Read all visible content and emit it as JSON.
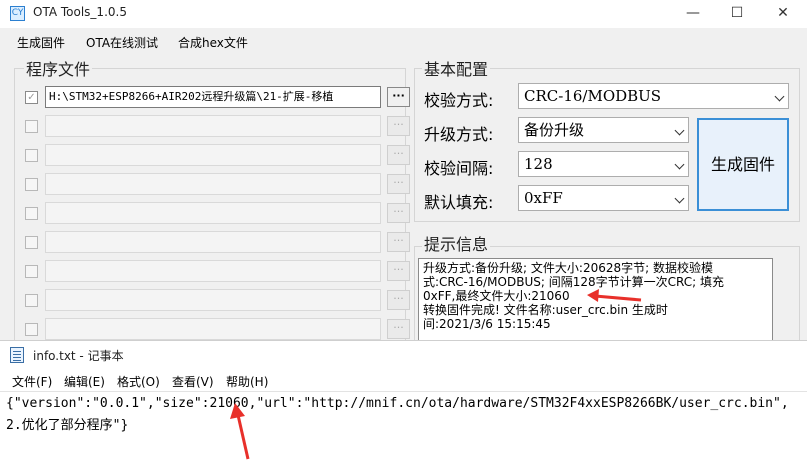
{
  "ota_window": {
    "title": "OTA Tools_1.0.5",
    "icon_text": "CY",
    "controls": {
      "minimize": "—",
      "maximize": "☐",
      "close": "✕"
    },
    "menu": [
      "生成固件",
      "OTA在线测试",
      "合成hex文件"
    ],
    "program_files": {
      "title": "程序文件",
      "rows": [
        {
          "checked": true,
          "path": "H:\\STM32+ESP8266+AIR202远程升级篇\\21-扩展-移植",
          "button": "···"
        },
        {
          "checked": false,
          "path": "",
          "button": "···"
        },
        {
          "checked": false,
          "path": "",
          "button": "···"
        },
        {
          "checked": false,
          "path": "",
          "button": "···"
        },
        {
          "checked": false,
          "path": "",
          "button": "···"
        },
        {
          "checked": false,
          "path": "",
          "button": "···"
        },
        {
          "checked": false,
          "path": "",
          "button": "···"
        },
        {
          "checked": false,
          "path": "",
          "button": "···"
        },
        {
          "checked": false,
          "path": "",
          "button": "···"
        }
      ]
    },
    "basic_config": {
      "title": "基本配置",
      "verify_method_label": "校验方式:",
      "verify_method_value": "CRC-16/MODBUS",
      "upgrade_method_label": "升级方式:",
      "upgrade_method_value": "备份升级",
      "verify_interval_label": "校验间隔:",
      "verify_interval_value": "128",
      "default_fill_label": "默认填充:",
      "default_fill_value": "0xFF",
      "generate_button": "生成固件"
    },
    "info": {
      "title": "提示信息",
      "lines": [
        "升级方式:备份升级; 文件大小:20628字节; 数据校验模",
        "式:CRC-16/MODBUS; 间隔128字节计算一次CRC; 填充",
        "0xFF,最终文件大小:21060",
        "转换固件完成! 文件名称:user_crc.bin    生成时",
        "间:2021/3/6 15:15:45"
      ]
    }
  },
  "notepad_window": {
    "title": "info.txt - 记事本",
    "menu": [
      "文件(F)",
      "编辑(E)",
      "格式(O)",
      "查看(V)",
      "帮助(H)"
    ],
    "lines": [
      "{\"version\":\"0.0.1\",\"size\":21060,\"url\":\"http://mnif.cn/ota/hardware/STM32F4xxESP8266BK/user_crc.bin\",",
      "2.优化了部分程序\"}"
    ]
  },
  "colors": {
    "accent": "#3b8fd6",
    "annotation_arrow": "#e8302a"
  }
}
